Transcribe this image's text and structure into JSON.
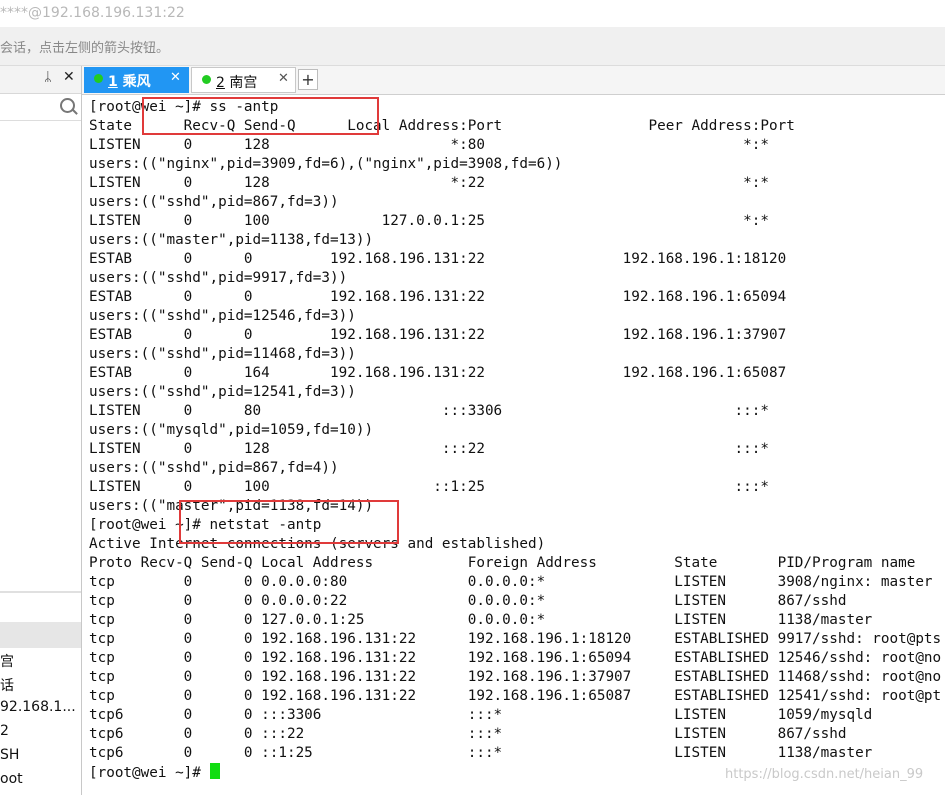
{
  "window": {
    "title": "****@192.168.196.131:22",
    "hint": "会话，点击左侧的箭头按钮。"
  },
  "sessions_panel": {
    "pin_glyph": "ᛦ",
    "close_glyph": "✕",
    "items": [
      "宫",
      "话",
      "92.168.1...",
      "2",
      "SH",
      "oot"
    ]
  },
  "tabs": [
    {
      "number": "1",
      "label": "乘风",
      "state": "active",
      "status_color": "#22cc22"
    },
    {
      "number": "2",
      "label": "南宫",
      "state": "inactive",
      "status_color": "#22cc22"
    }
  ],
  "add_tab_label": "+",
  "tab_close_glyph": "✕",
  "terminal": {
    "lines": [
      "[root@wei ~]# ss -antp",
      "State      Recv-Q Send-Q      Local Address:Port                 Peer Address:Port",
      "LISTEN     0      128                     *:80                              *:*",
      "users:((\"nginx\",pid=3909,fd=6),(\"nginx\",pid=3908,fd=6))",
      "LISTEN     0      128                     *:22                              *:*",
      "users:((\"sshd\",pid=867,fd=3))",
      "LISTEN     0      100             127.0.0.1:25                              *:*",
      "users:((\"master\",pid=1138,fd=13))",
      "ESTAB      0      0         192.168.196.131:22                192.168.196.1:18120",
      "users:((\"sshd\",pid=9917,fd=3))",
      "ESTAB      0      0         192.168.196.131:22                192.168.196.1:65094",
      "users:((\"sshd\",pid=12546,fd=3))",
      "ESTAB      0      0         192.168.196.131:22                192.168.196.1:37907",
      "users:((\"sshd\",pid=11468,fd=3))",
      "ESTAB      0      164       192.168.196.131:22                192.168.196.1:65087",
      "users:((\"sshd\",pid=12541,fd=3))",
      "LISTEN     0      80                     :::3306                           :::*",
      "users:((\"mysqld\",pid=1059,fd=10))",
      "LISTEN     0      128                    :::22                             :::*",
      "users:((\"sshd\",pid=867,fd=4))",
      "LISTEN     0      100                   ::1:25                             :::*",
      "users:((\"master\",pid=1138,fd=14))",
      "[root@wei ~]# netstat -antp",
      "Active Internet connections (servers and established)",
      "Proto Recv-Q Send-Q Local Address           Foreign Address         State       PID/Program name",
      "tcp        0      0 0.0.0.0:80              0.0.0.0:*               LISTEN      3908/nginx: master",
      "tcp        0      0 0.0.0.0:22              0.0.0.0:*               LISTEN      867/sshd",
      "tcp        0      0 127.0.0.1:25            0.0.0.0:*               LISTEN      1138/master",
      "tcp        0      0 192.168.196.131:22      192.168.196.1:18120     ESTABLISHED 9917/sshd: root@pts",
      "tcp        0      0 192.168.196.131:22      192.168.196.1:65094     ESTABLISHED 12546/sshd: root@no",
      "tcp        0      0 192.168.196.131:22      192.168.196.1:37907     ESTABLISHED 11468/sshd: root@no",
      "tcp        0      0 192.168.196.131:22      192.168.196.1:65087     ESTABLISHED 12541/sshd: root@pt",
      "tcp6       0      0 :::3306                 :::*                    LISTEN      1059/mysqld",
      "tcp6       0      0 :::22                   :::*                    LISTEN      867/sshd",
      "tcp6       0      0 ::1:25                  :::*                    LISTEN      1138/master"
    ],
    "prompt": "[root@wei ~]# ",
    "cursor_color": "#11dd11",
    "annotation_color": "#e03a3a"
  },
  "watermark": "https://blog.csdn.net/heian_99"
}
